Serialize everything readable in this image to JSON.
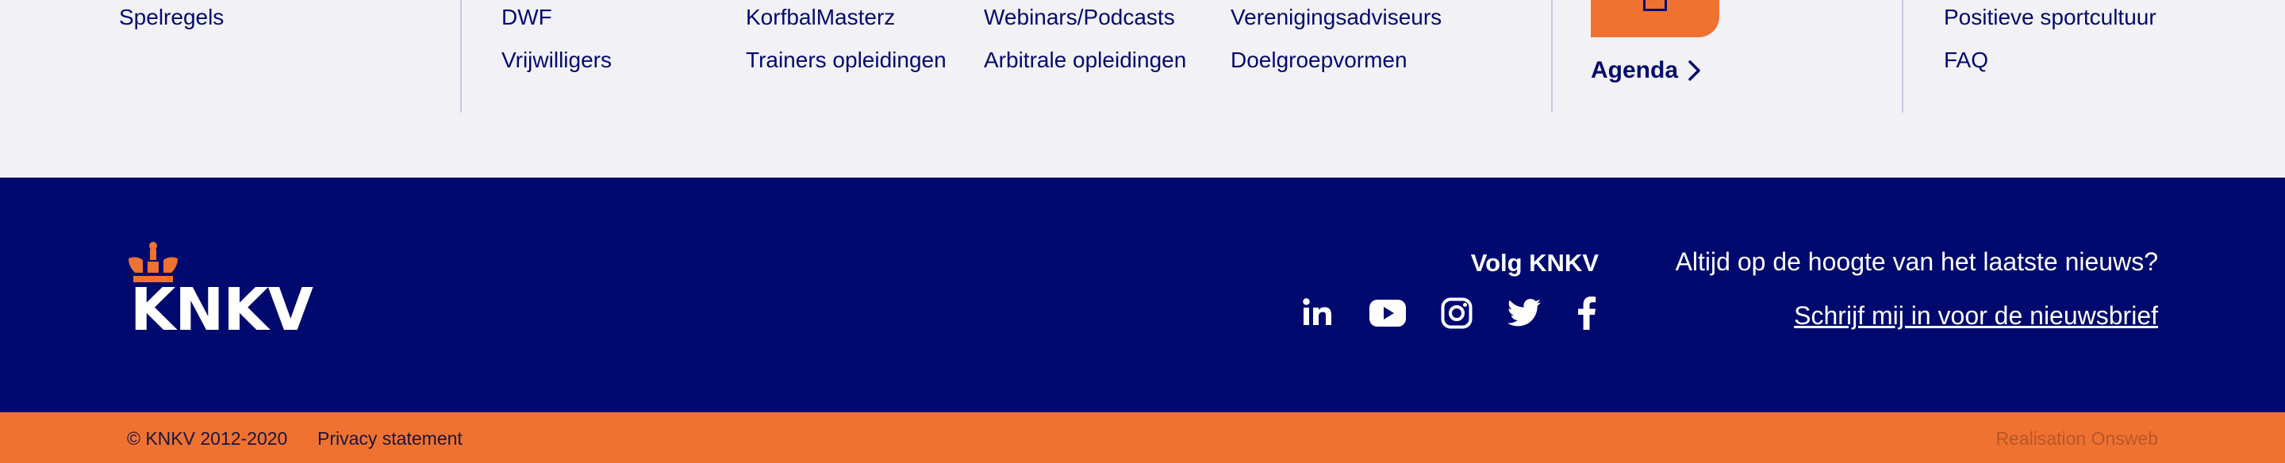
{
  "top_links": {
    "col1": [
      "Spelregels"
    ],
    "col2": [
      "DWF",
      "Vrijwilligers"
    ],
    "col3": [
      "KorfbalMasterz",
      "Trainers opleidingen"
    ],
    "col4": [
      "Webinars/Podcasts",
      "Arbitrale opleidingen"
    ],
    "col5": [
      "Verenigingsadviseurs",
      "Doelgroepvormen"
    ],
    "agenda_label": "Agenda",
    "col6": [
      "Positieve sportcultuur",
      "FAQ"
    ]
  },
  "footer": {
    "logo_text": "KNKV",
    "follow_title": "Volg KNKV",
    "socials": [
      {
        "name": "linkedin-icon"
      },
      {
        "name": "youtube-icon"
      },
      {
        "name": "instagram-icon"
      },
      {
        "name": "twitter-icon"
      },
      {
        "name": "facebook-icon"
      }
    ],
    "newsletter_question": "Altijd op de hoogte van het laatste nieuws?",
    "newsletter_link": "Schrijf mij in voor de nieuwsbrief"
  },
  "bottom_bar": {
    "copyright": "© KNKV 2012-2020",
    "privacy": "Privacy statement",
    "realisation": "Realisation Onsweb"
  },
  "colors": {
    "navy": "#000a6e",
    "orange": "#ef7230",
    "light_bg": "#f1f1f6",
    "link_text": "#050a6e"
  }
}
